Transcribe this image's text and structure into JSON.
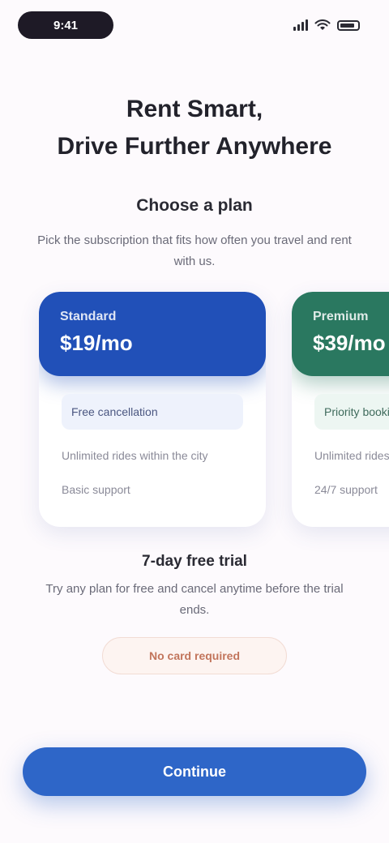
{
  "status_bar": {
    "time": "9:41"
  },
  "hero": {
    "line1": "Rent Smart,",
    "line2": "Drive Further Anywhere"
  },
  "plans_section": {
    "title": "Choose a plan",
    "description": "Pick the subscription that fits how often you travel and rent with us."
  },
  "plans": [
    {
      "name": "Standard",
      "price": "$19/mo",
      "highlight": "Free cancellation",
      "feature_1": "Unlimited rides within the city",
      "feature_2": "Basic support"
    },
    {
      "name": "Premium",
      "price": "$39/mo",
      "highlight": "Priority booking",
      "feature_1": "Unlimited rides nationwide",
      "feature_2": "24/7 support"
    }
  ],
  "trial": {
    "title": "7-day free trial",
    "description": "Try any plan for free and cancel anytime before the trial ends.",
    "chip_label": "No card required"
  },
  "cta": {
    "label": "Continue"
  },
  "colors": {
    "primary": "#2e66c8",
    "plan_blue": "#2150b8",
    "plan_green": "#2a7860",
    "accent_chip": "#c2755c"
  }
}
